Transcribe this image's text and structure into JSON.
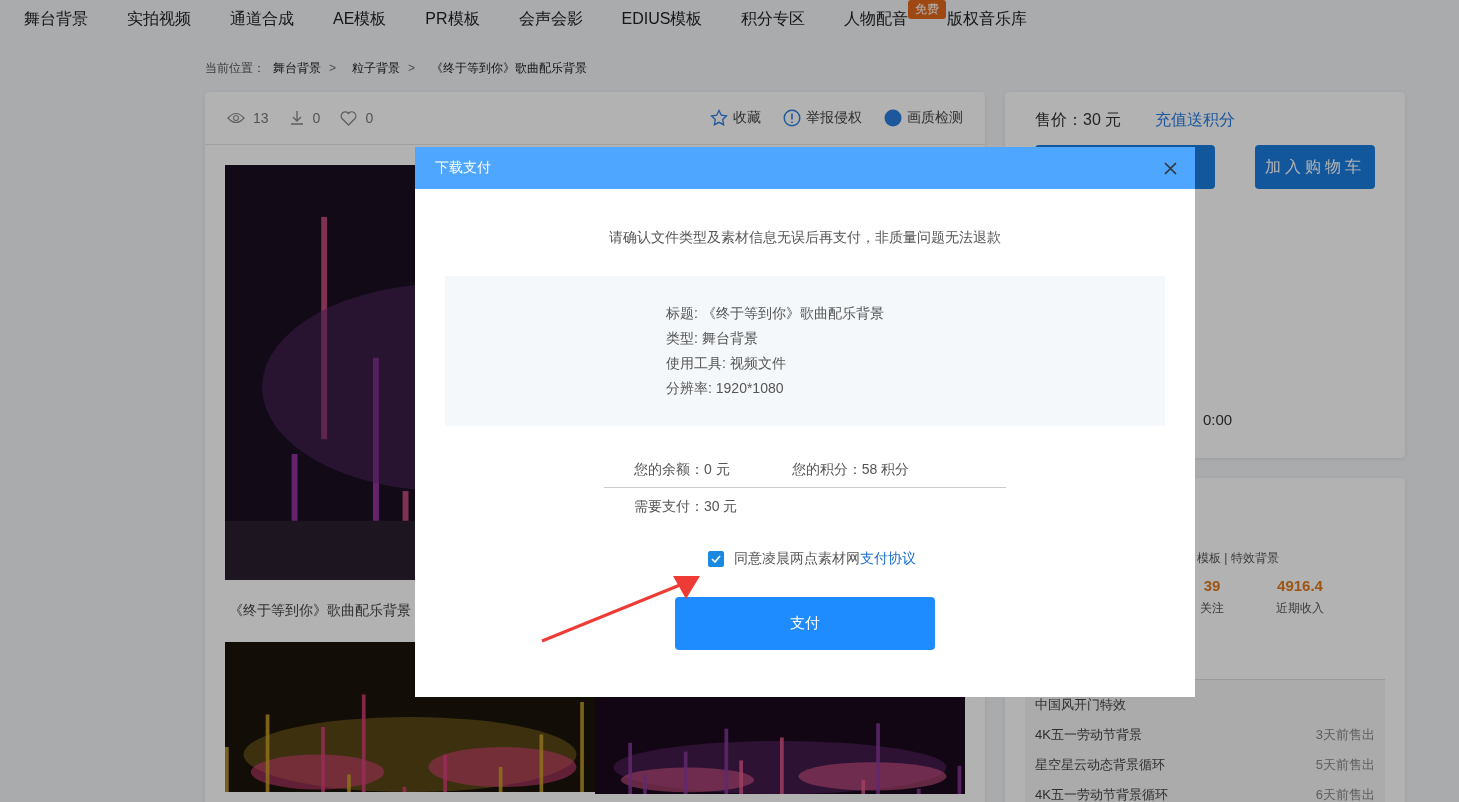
{
  "nav": [
    {
      "label": "舞台背景"
    },
    {
      "label": "实拍视频"
    },
    {
      "label": "通道合成"
    },
    {
      "label": "AE模板"
    },
    {
      "label": "PR模板"
    },
    {
      "label": "会声会影"
    },
    {
      "label": "EDIUS模板"
    },
    {
      "label": "积分专区"
    },
    {
      "label": "人物配音",
      "badge": "免费"
    },
    {
      "label": "版权音乐库"
    }
  ],
  "breadcrumb": {
    "prefix": "当前位置：",
    "separator": ">",
    "items": [
      "舞台背景",
      "粒子背景",
      "《终于等到你》歌曲配乐背景"
    ]
  },
  "detail": {
    "stats": [
      {
        "kind": "views",
        "value": "13"
      },
      {
        "kind": "downloads",
        "value": "0"
      },
      {
        "kind": "likes",
        "value": "0"
      }
    ],
    "actions": [
      {
        "kind": "star",
        "label": "收藏"
      },
      {
        "kind": "alert",
        "label": "举报侵权"
      },
      {
        "kind": "dot",
        "label": "画质检测"
      }
    ],
    "caption": "《终于等到你》歌曲配乐背景"
  },
  "price_panel": {
    "price_label": "售价：",
    "price": "30 元",
    "recharge_link": "充值送积分",
    "cart_button": "加入购物车",
    "time": "0:00"
  },
  "author_panel": {
    "tags": "模板 | 特效背景",
    "stats": [
      {
        "value": "39",
        "label": "关注"
      },
      {
        "value": "4916.4",
        "label": "近期收入"
      }
    ],
    "sales": [
      {
        "title": "中国风开门特效"
      },
      {
        "title": "4K五一劳动节背景",
        "time": "3天前售出"
      },
      {
        "title": "星空星云动态背景循环",
        "time": "5天前售出"
      },
      {
        "title": "4K五一劳动节背景循环",
        "time": "6天前售出"
      }
    ]
  },
  "modal": {
    "title": "下载支付",
    "notice": "请确认文件类型及素材信息无误后再支付，非质量问题无法退款",
    "info": [
      "标题: 《终于等到你》歌曲配乐背景",
      "类型: 舞台背景",
      "使用工具: 视频文件",
      "分辨率: 1920*1080"
    ],
    "balance": "您的余额：0 元",
    "points": "您的积分：58 积分",
    "due": "需要支付：30 元",
    "agreement": {
      "text": "同意凌晨两点素材网",
      "link": "支付协议",
      "checked": true
    },
    "pay_button": "支付"
  }
}
